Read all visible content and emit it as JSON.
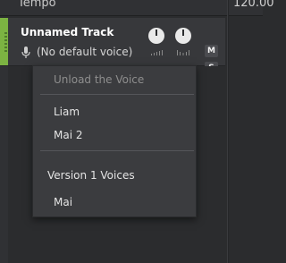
{
  "timeline": {
    "tempo_label": "Tempo",
    "tempo_value": "120.00"
  },
  "track": {
    "name": "Unnamed Track",
    "voice": "(No default voice)",
    "color": "#7cb342",
    "mute_label": "M",
    "solo_label": "S"
  },
  "voice_menu": {
    "unload": "Unload the Voice",
    "voices": [
      "Liam",
      "Mai 2"
    ],
    "v1_section": "Version 1 Voices",
    "v1_voices": [
      "Mai"
    ]
  }
}
